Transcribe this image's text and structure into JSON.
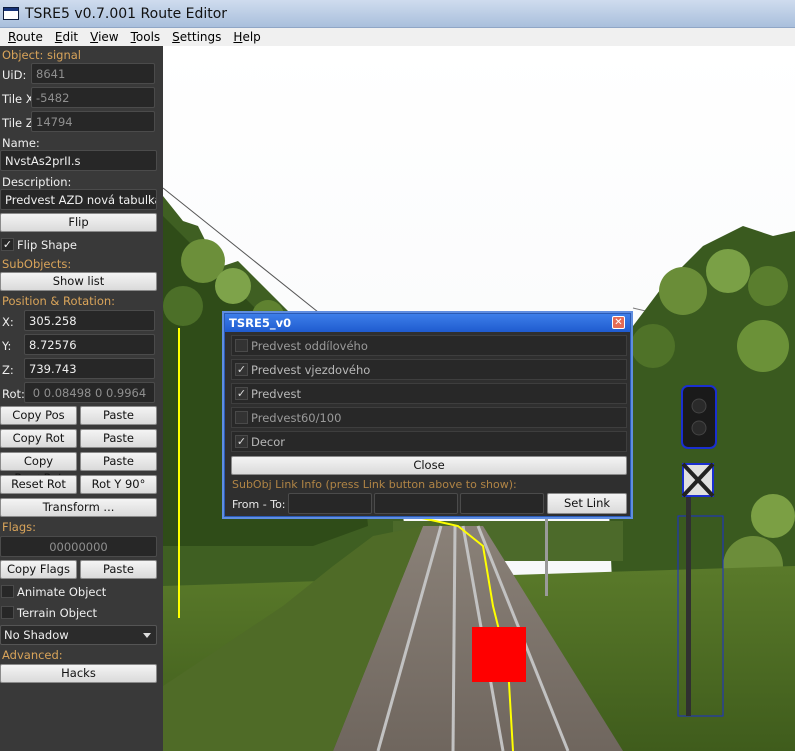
{
  "window": {
    "title": "TSRE5 v0.7.001 Route Editor"
  },
  "menu": [
    {
      "u": "R",
      "rest": "oute"
    },
    {
      "u": "E",
      "rest": "dit"
    },
    {
      "u": "V",
      "rest": "iew"
    },
    {
      "u": "T",
      "rest": "ools"
    },
    {
      "u": "S",
      "rest": "ettings"
    },
    {
      "u": "H",
      "rest": "elp"
    }
  ],
  "panel": {
    "object_label": "Object: signal",
    "uid_label": "UiD:",
    "uid_value": "8641",
    "tilex_label": "Tile X:",
    "tilex_value": "-5482",
    "tilez_label": "Tile Z:",
    "tilez_value": "14794",
    "name_label": "Name:",
    "name_value": "NvstAs2prII.s",
    "desc_label": "Description:",
    "desc_value": "Predvest AZD nová tabulka",
    "flip_button": "Flip",
    "flip_shape_label": "Flip Shape",
    "flip_shape_checked": "✓",
    "subobjects_label": "SubObjects:",
    "show_list_button": "Show list",
    "posrot_label": "Position & Rotation:",
    "x_label": "X:",
    "x_value": "305.258",
    "y_label": "Y:",
    "y_value": "8.72576",
    "z_label": "Z:",
    "z_value": "739.743",
    "rot_label": "Rot:",
    "rot_value": "0 0.08498 0 0.9964",
    "copy_pos": "Copy Pos",
    "paste_pos": "Paste",
    "copy_rot": "Copy Rot",
    "paste_rot": "Paste",
    "copy_posrot": "Copy Pos+Rot",
    "paste_posrot": "Paste",
    "reset_rot": "Reset Rot",
    "rot_y90": "Rot Y 90°",
    "transform": "Transform ...",
    "flags_label": "Flags:",
    "flags_value": "00000000",
    "copy_flags": "Copy Flags",
    "paste_flags": "Paste",
    "animate_label": "Animate Object",
    "terrain_label": "Terrain Object",
    "shadow_value": "No Shadow",
    "advanced_label": "Advanced:",
    "hacks_button": "Hacks"
  },
  "dialog": {
    "title": "TSRE5_v0",
    "items": [
      {
        "label": "Predvest oddílového",
        "checked": ""
      },
      {
        "label": "Predvest vjezdového",
        "checked": "✓"
      },
      {
        "label": "Predvest",
        "checked": "✓"
      },
      {
        "label": "Predvest60/100",
        "checked": ""
      },
      {
        "label": "Decor",
        "checked": "✓"
      }
    ],
    "close_button": "Close",
    "link_info": "SubObj Link Info (press Link button above to show):",
    "from_to_label": "From - To:",
    "set_link_button": "Set Link"
  },
  "colors": {
    "section_label": "#d9a45a",
    "marker_red": "#ff0000",
    "track_line": "#ffff00",
    "signal_outline": "#1a2fd0"
  }
}
